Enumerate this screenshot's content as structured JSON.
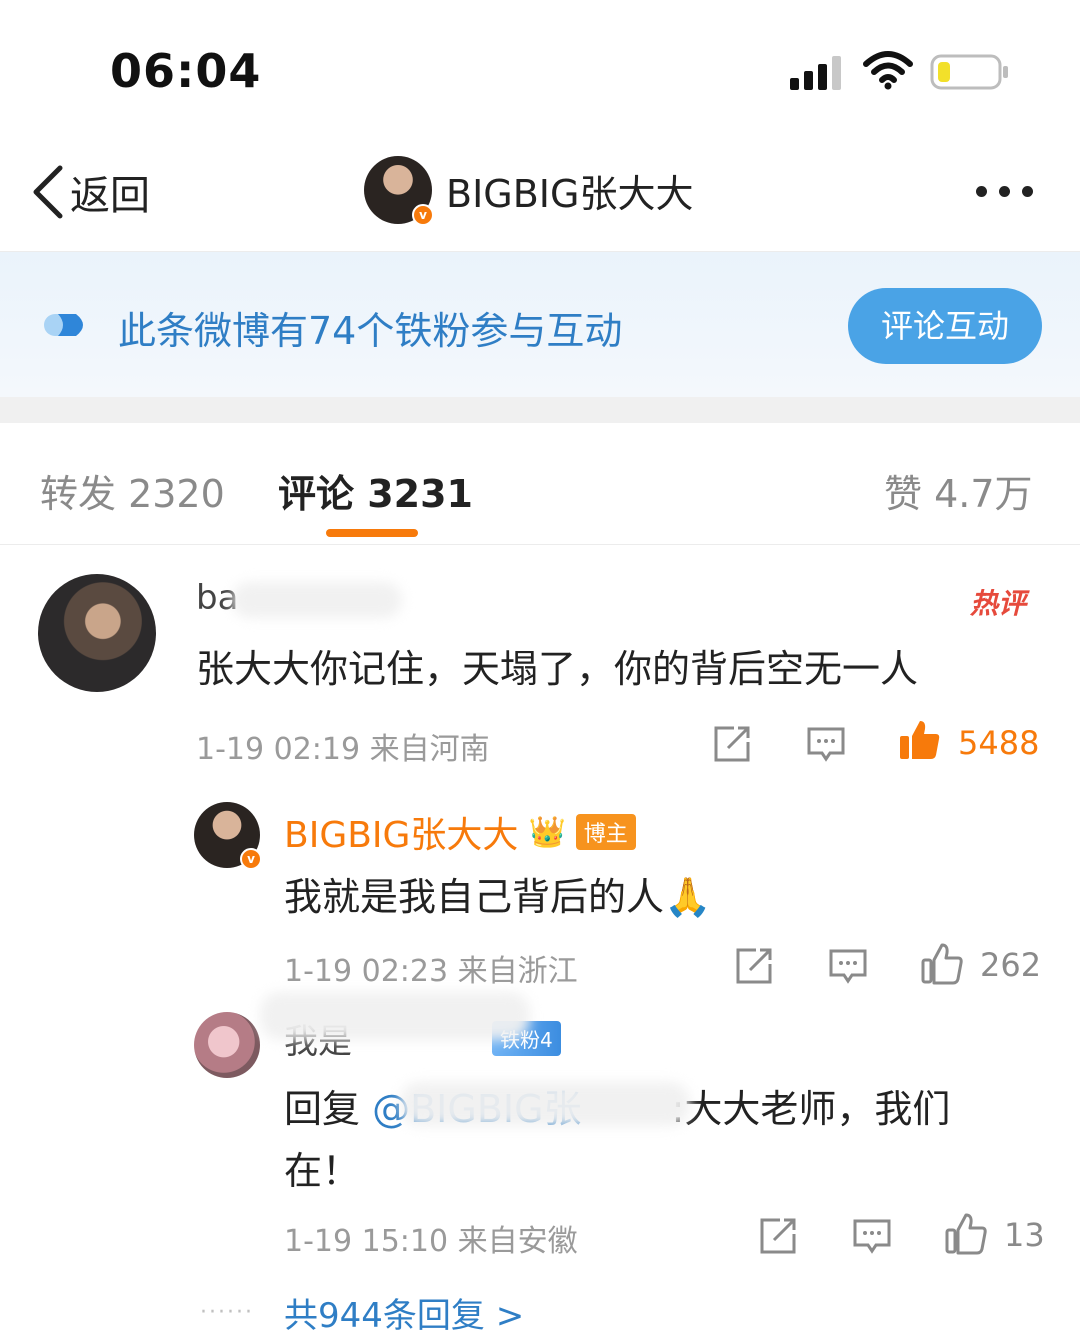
{
  "status_bar": {
    "time": "06:04"
  },
  "nav": {
    "back_label": "返回",
    "title": "BIGBIG张大大",
    "verified_mark": "v"
  },
  "banner": {
    "text": "此条微博有74个铁粉参与互动",
    "button": "评论互动"
  },
  "tabs": {
    "repost": "转发 2320",
    "comment": "评论 3231",
    "like": "赞 4.7万"
  },
  "comments": [
    {
      "user": "ba",
      "hot_tag": "热评",
      "text": "张大大你记住，天塌了，你的背后空无一人",
      "meta": "1-19 02:19  来自河南",
      "likes": "5488"
    }
  ],
  "replies": [
    {
      "user": "BIGBIG张大大",
      "badge": "博主",
      "text": "我就是我自己背后的人🙏",
      "meta": "1-19 02:23  来自浙江",
      "likes": "262"
    },
    {
      "user": "我是",
      "fan_badge": "铁粉4",
      "prefix": "回复 ",
      "mention": "@BIGBIG张",
      "text_line1_tail": ":大大老师，我们",
      "text_line2": "在！",
      "meta": "1-19 15:10  来自安徽",
      "likes": "13"
    }
  ],
  "more_replies": "共944条回复 >",
  "colors": {
    "accent_orange": "#f77a0b",
    "link_blue": "#2f7ec5",
    "banner_button": "#4aa3e6",
    "hot_red": "#e64a3c"
  }
}
